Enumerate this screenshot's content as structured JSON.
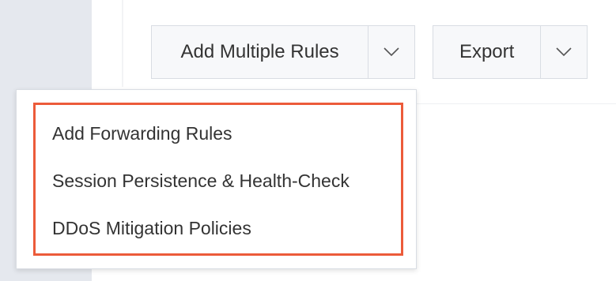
{
  "toolbar": {
    "add_multiple_rules_label": "Add Multiple Rules",
    "export_label": "Export",
    "caret_icon": "chevron-down-icon"
  },
  "dropdown": {
    "items": [
      {
        "label": "Add Forwarding Rules"
      },
      {
        "label": "Session Persistence & Health-Check"
      },
      {
        "label": "DDoS Mitigation Policies"
      }
    ],
    "highlight_color": "#ec5b3a"
  },
  "colors": {
    "sidebar": "#e5e8ee",
    "button_bg": "#f7f8fa",
    "button_border": "#d9dde3",
    "text": "#333333"
  }
}
